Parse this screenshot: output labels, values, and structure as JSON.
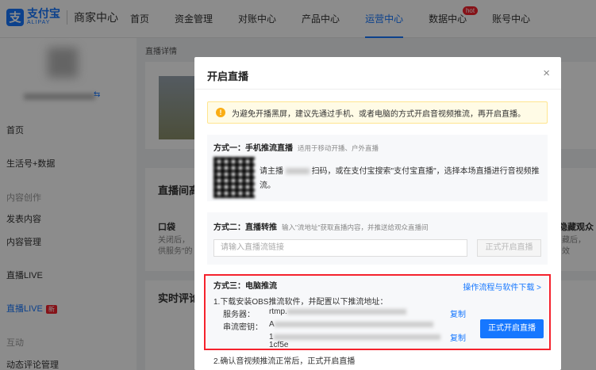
{
  "logo": {
    "mark": "支",
    "cn": "支付宝",
    "en": "ALIPAY",
    "title": "商家中心"
  },
  "nav": {
    "items": [
      {
        "label": "首页"
      },
      {
        "label": "资金管理"
      },
      {
        "label": "对账中心"
      },
      {
        "label": "产品中心"
      },
      {
        "label": "运营中心"
      },
      {
        "label": "数据中心"
      },
      {
        "label": "账号中心"
      }
    ],
    "hot_badge": "hot"
  },
  "sidebar": {
    "account_link": "⇆",
    "items": {
      "home": "首页",
      "life_data": "生活号+数据",
      "content_group": "内容创作",
      "publish": "发表内容",
      "content_manage": "内容管理",
      "live_live": "直播LIVE",
      "live_active": "直播LIVE",
      "new_tag": "新",
      "interact_group": "互动",
      "comment_manage": "动态评论管理"
    }
  },
  "background": {
    "breadcrumb": "直播详情",
    "live_room": "直播间高",
    "pocket_title": "口袋",
    "pocket_line1": "关闭后，",
    "pocket_line2": "供服务\"的",
    "realtime": "实时评论",
    "hide_viewer": "隐藏观众",
    "right_line1": "藏后，",
    "right_line2": "效"
  },
  "modal": {
    "title": "开启直播",
    "close": "×",
    "notice": "为避免开播黑屏，建议先通过手机、或者电脑的方式开启音视频推流，再开启直播。",
    "method1": {
      "title": "方式一：手机推流直播",
      "sub": "适用于移动开播、户外直播",
      "text_a": "请主播",
      "text_b": "扫码，或在支付宝搜索\"支付宝直播\"，选择本场直播进行音视频推流。"
    },
    "method2": {
      "title": "方式二：直播转推",
      "sub": "输入\"流地址\"获取直播内容，并推送给观众直播间",
      "placeholder": "请输入直播流链接",
      "button": "正式开启直播"
    },
    "method3": {
      "title": "方式三：电脑推流",
      "download": "操作流程与软件下载",
      "download_arrow": ">",
      "step1": "1.下载安装OBS推流软件，并配置以下推流地址：",
      "server_label": "服务器：",
      "server_value": "rtmp.",
      "key_label": "串流密钥：",
      "key_value_a": "A",
      "key_value_b": "1",
      "key_value_c": "1cf5e",
      "copy1": "复制",
      "copy2": "复制",
      "button": "正式开启直播"
    },
    "step2": "2.确认音视频推流正常后，正式开启直播"
  }
}
